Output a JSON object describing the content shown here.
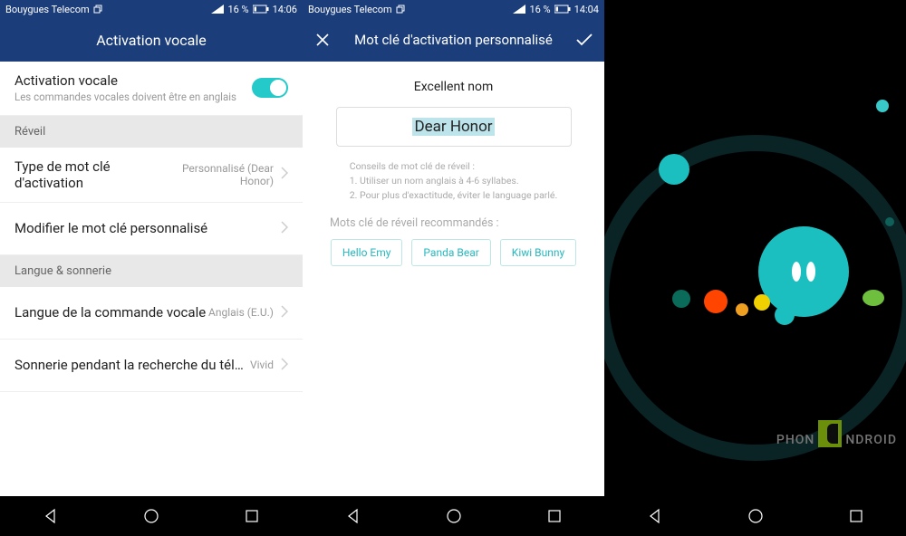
{
  "status": {
    "carrier": "Bouygues Telecom",
    "battery": "16 %",
    "time1": "14:06",
    "time2": "14:04"
  },
  "screen1": {
    "title": "Activation vocale",
    "toggle_row": {
      "primary": "Activation vocale",
      "secondary": "Les commandes vocales doivent être en anglais"
    },
    "section_wake": "Réveil",
    "row_type": {
      "primary": "Type de mot clé d'activation",
      "value": "Personnalisé (Dear Honor)"
    },
    "row_modify": {
      "primary": "Modifier le mot clé personnalisé"
    },
    "section_lang": "Langue & sonnerie",
    "row_lang": {
      "primary": "Langue de la commande vocale",
      "value": "Anglais (E.U.)"
    },
    "row_ring": {
      "primary": "Sonnerie pendant la recherche du tél…",
      "value": "Vivid"
    }
  },
  "screen2": {
    "title": "Mot clé d'activation personnalisé",
    "excellent": "Excellent nom",
    "input_value": "Dear Honor",
    "tips": "Conseils de mot clé de réveil :\n1. Utiliser un nom anglais à 4-6 syllabes.\n2. Pour plus d'exactitude, éviter le language parlé.",
    "recommend_label": "Mots clé de réveil recommandés :",
    "chips": [
      "Hello Emy",
      "Panda Bear",
      "Kiwi Bunny"
    ]
  },
  "watermark": {
    "text_pre": "PHON",
    "text_post": "NDROID"
  }
}
